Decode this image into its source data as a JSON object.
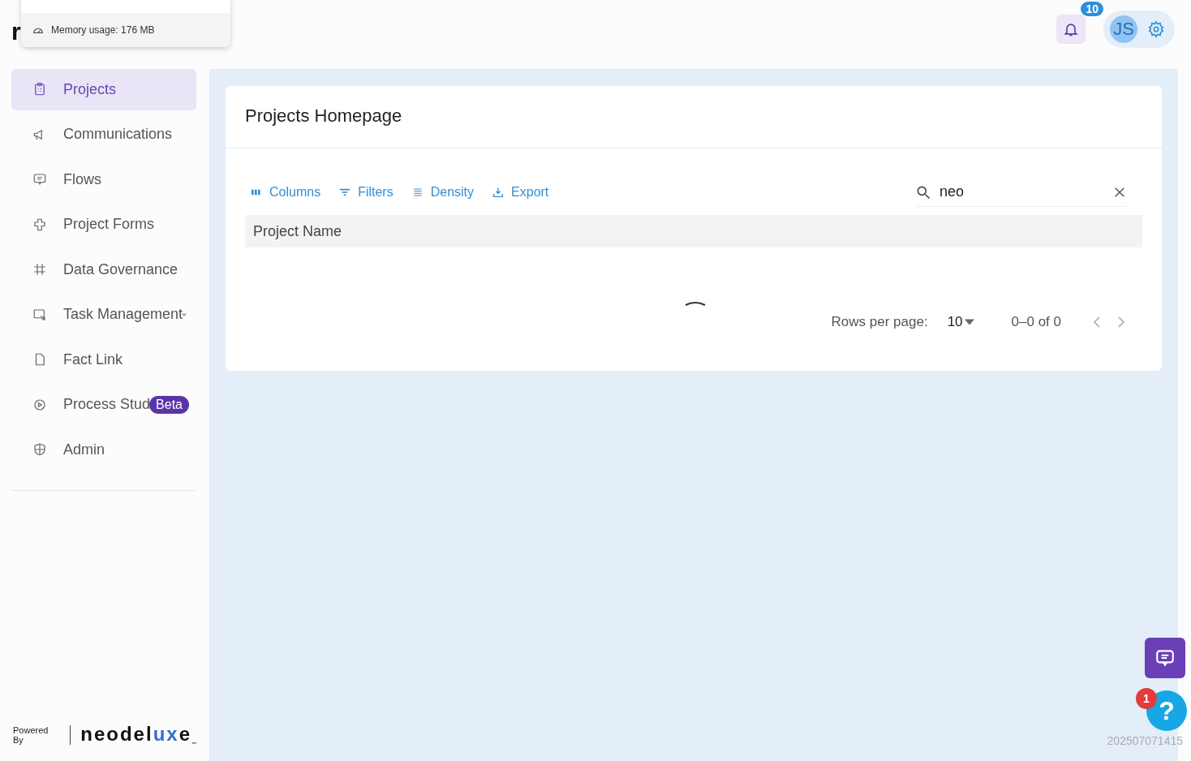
{
  "header": {
    "logo_fragment": "r",
    "notifications": {
      "count": "10"
    },
    "user": {
      "initials": "JS"
    }
  },
  "memory_popup": {
    "text": "Memory usage: 176 MB"
  },
  "sidebar": {
    "items": [
      {
        "label": "Projects",
        "selected": true
      },
      {
        "label": "Communications",
        "selected": false
      },
      {
        "label": "Flows",
        "selected": false
      },
      {
        "label": "Project Forms",
        "selected": false
      },
      {
        "label": "Data Governance",
        "selected": false
      },
      {
        "label": "Task Management",
        "selected": false,
        "expandable": true
      },
      {
        "label": "Fact Link",
        "selected": false
      },
      {
        "label": "Process Stud",
        "selected": false,
        "badge": "Beta"
      },
      {
        "label": "Admin",
        "selected": false
      }
    ],
    "footer": {
      "powered_by": "Powered By",
      "logo": [
        {
          "text": "neodel",
          "accent": false
        },
        {
          "text": "ux",
          "accent": true
        },
        {
          "text": "e",
          "accent": false
        }
      ],
      "logo_mark": "™"
    }
  },
  "card": {
    "title": "Projects Homepage",
    "toolbar": [
      {
        "label": "Columns",
        "kind": "columns"
      },
      {
        "label": "Filters",
        "kind": "filters"
      },
      {
        "label": "Density",
        "kind": "density"
      },
      {
        "label": "Export",
        "kind": "export"
      }
    ],
    "search": {
      "value": "neo"
    },
    "table": {
      "columns": [
        "Project Name"
      ],
      "loading": true
    },
    "pagination": {
      "rows_label": "Rows per page:",
      "rows_value": "10",
      "range": "0–0 of 0"
    }
  },
  "help": {
    "badge": "1",
    "label": "?"
  },
  "build": "202507071415"
}
